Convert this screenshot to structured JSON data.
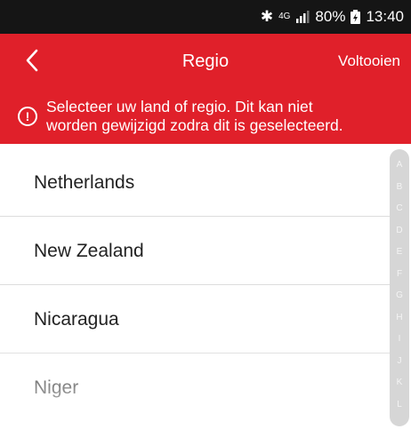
{
  "status_bar": {
    "bluetooth": "✱",
    "network": "4G",
    "battery": "80%",
    "time": "13:40"
  },
  "app_bar": {
    "title": "Regio",
    "done_label": "Voltooien"
  },
  "notice": {
    "line1": "Selecteer uw land of regio. Dit kan niet",
    "line2": "worden gewijzigd zodra dit is geselecteerd."
  },
  "countries": [
    {
      "name": "Netherlands"
    },
    {
      "name": "New Zealand"
    },
    {
      "name": "Nicaragua"
    },
    {
      "name": "Niger"
    }
  ],
  "index_letters": [
    "A",
    "B",
    "C",
    "D",
    "E",
    "F",
    "G",
    "H",
    "I",
    "J",
    "K",
    "L"
  ],
  "colors": {
    "accent": "#e0202a",
    "status_bar": "#151515"
  }
}
